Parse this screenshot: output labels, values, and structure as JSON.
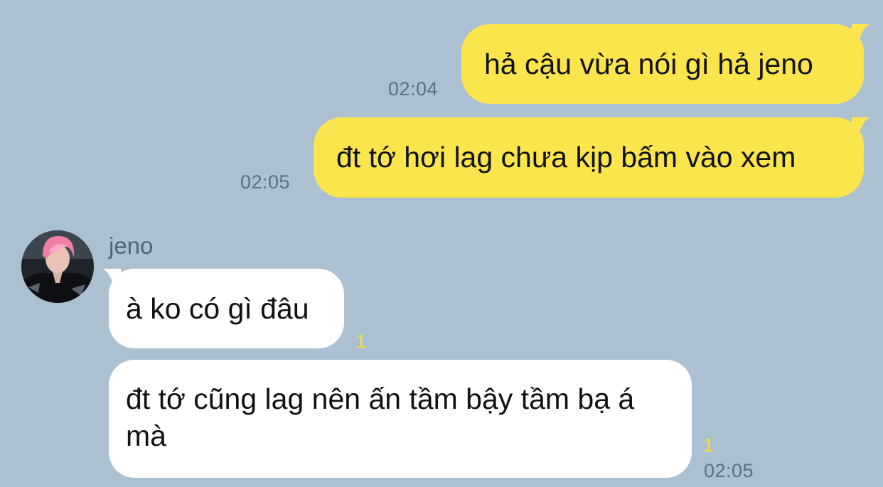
{
  "conversation": {
    "messages": [
      {
        "direction": "outgoing",
        "text": "hả cậu vừa nói gì hả jeno",
        "time": "02:04"
      },
      {
        "direction": "outgoing",
        "text": "đt tớ hơi lag chưa kịp bấm vào xem",
        "time": "02:05"
      },
      {
        "direction": "incoming",
        "sender": "jeno",
        "text": "à ko có gì đâu",
        "unread": "1"
      },
      {
        "direction": "incoming",
        "text": "đt tớ cũng lag nên ấn tầm bậy tầm bạ á mà",
        "unread": "1",
        "time": "02:05"
      }
    ]
  },
  "colors": {
    "background": "#abc1d1",
    "outgoing_bubble": "#fbe54d",
    "incoming_bubble": "#ffffff",
    "timestamp": "#5f6e7a",
    "unread_count": "#f4de35"
  },
  "icons": {
    "avatar": "profile-photo-pink-hair"
  }
}
